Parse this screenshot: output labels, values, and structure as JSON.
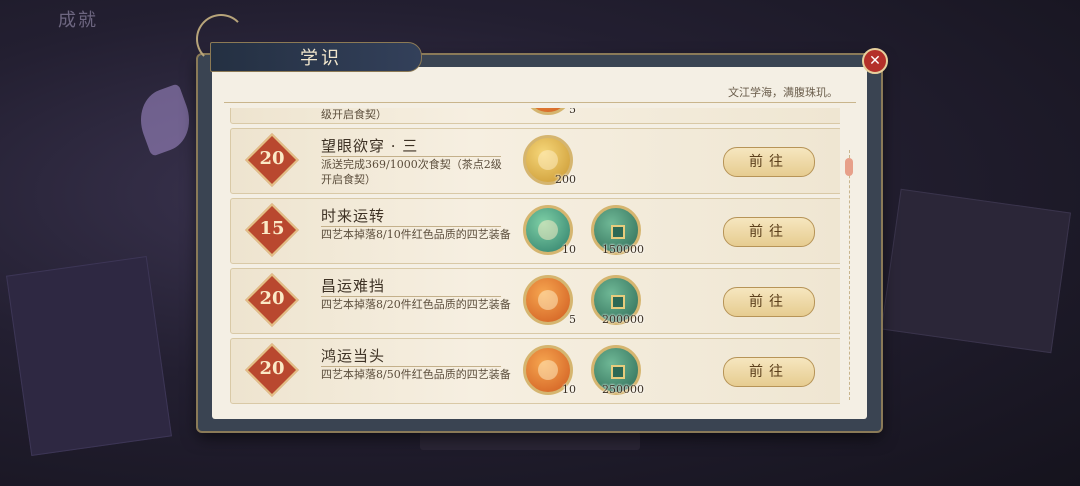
{
  "background": {
    "top_title": "成就"
  },
  "dialog": {
    "title": "学识",
    "subtitle": "文江学海，满腹珠玑。",
    "close_icon": "close-x"
  },
  "tasks": [
    {
      "badge": "",
      "title": "",
      "desc": "级开启食契）",
      "rewards": [
        {
          "type": "orange",
          "amount": "5"
        }
      ],
      "button": ""
    },
    {
      "badge": "20",
      "title": "望眼欲穿 · 三",
      "desc": "派送完成369/1000次食契（茶点2级开启食契）",
      "rewards": [
        {
          "type": "gold",
          "amount": "200"
        }
      ],
      "button": "前往"
    },
    {
      "badge": "15",
      "title": "时来运转",
      "desc": "四艺本掉落8/10件红色品质的四艺装备",
      "rewards": [
        {
          "type": "teal",
          "amount": "10"
        },
        {
          "type": "coin",
          "amount": "150000"
        }
      ],
      "button": "前往"
    },
    {
      "badge": "20",
      "title": "昌运难挡",
      "desc": "四艺本掉落8/20件红色品质的四艺装备",
      "rewards": [
        {
          "type": "orange",
          "amount": "5"
        },
        {
          "type": "coin",
          "amount": "200000"
        }
      ],
      "button": "前往"
    },
    {
      "badge": "20",
      "title": "鸿运当头",
      "desc": "四艺本掉落8/50件红色品质的四艺装备",
      "rewards": [
        {
          "type": "orange",
          "amount": "10"
        },
        {
          "type": "coin",
          "amount": "250000"
        }
      ],
      "button": "前往"
    }
  ]
}
